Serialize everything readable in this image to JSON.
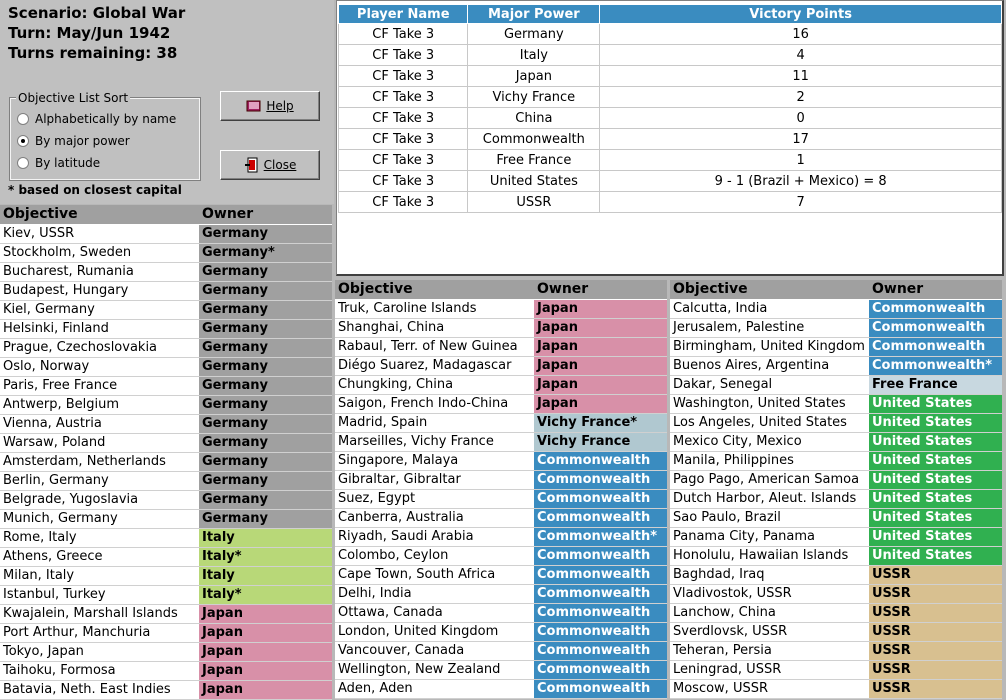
{
  "scenario": {
    "line1": "Scenario: Global War",
    "line2": "Turn: May/Jun 1942",
    "line3": "Turns remaining: 38"
  },
  "sort": {
    "legend": "Objective List Sort",
    "options": [
      "Alphabetically by name",
      "By major power",
      "By latitude"
    ],
    "selected_index": 1
  },
  "footnote": "* based on closest capital",
  "buttons": {
    "help": "Help",
    "close": "Close"
  },
  "vp_table": {
    "headers": [
      "Player Name",
      "Major Power",
      "Victory Points"
    ],
    "rows": [
      [
        "CF Take 3",
        "Germany",
        "16"
      ],
      [
        "CF Take 3",
        "Italy",
        "4"
      ],
      [
        "CF Take 3",
        "Japan",
        "11"
      ],
      [
        "CF Take 3",
        "Vichy France",
        "2"
      ],
      [
        "CF Take 3",
        "China",
        "0"
      ],
      [
        "CF Take 3",
        "Commonwealth",
        "17"
      ],
      [
        "CF Take 3",
        "Free France",
        "1"
      ],
      [
        "CF Take 3",
        "United States",
        "9 - 1 (Brazil + Mexico) = 8"
      ],
      [
        "CF Take 3",
        "USSR",
        "7"
      ]
    ]
  },
  "owner_colors": {
    "Germany": "#a0a0a0",
    "Italy": "#b8d878",
    "Japan": "#d890a8",
    "Vichy France": "#b0c8d0",
    "Commonwealth": "#3a8cc0",
    "Free France": "#c8d8e0",
    "United States": "#30b050",
    "USSR": "#d8c090"
  },
  "objective_lists": [
    {
      "headers": [
        "Objective",
        "Owner"
      ],
      "rows": [
        [
          "Kiev, USSR",
          "Germany"
        ],
        [
          "Stockholm, Sweden",
          "Germany*"
        ],
        [
          "Bucharest, Rumania",
          "Germany"
        ],
        [
          "Budapest, Hungary",
          "Germany"
        ],
        [
          "Kiel, Germany",
          "Germany"
        ],
        [
          "Helsinki, Finland",
          "Germany"
        ],
        [
          "Prague, Czechoslovakia",
          "Germany"
        ],
        [
          "Oslo, Norway",
          "Germany"
        ],
        [
          "Paris, Free France",
          "Germany"
        ],
        [
          "Antwerp, Belgium",
          "Germany"
        ],
        [
          "Vienna, Austria",
          "Germany"
        ],
        [
          "Warsaw, Poland",
          "Germany"
        ],
        [
          "Amsterdam, Netherlands",
          "Germany"
        ],
        [
          "Berlin, Germany",
          "Germany"
        ],
        [
          "Belgrade, Yugoslavia",
          "Germany"
        ],
        [
          "Munich, Germany",
          "Germany"
        ],
        [
          "Rome, Italy",
          "Italy"
        ],
        [
          "Athens, Greece",
          "Italy*"
        ],
        [
          "Milan, Italy",
          "Italy"
        ],
        [
          "Istanbul, Turkey",
          "Italy*"
        ],
        [
          "Kwajalein, Marshall Islands",
          "Japan"
        ],
        [
          "Port Arthur, Manchuria",
          "Japan"
        ],
        [
          "Tokyo, Japan",
          "Japan"
        ],
        [
          "Taihoku, Formosa",
          "Japan"
        ],
        [
          "Batavia, Neth. East Indies",
          "Japan"
        ]
      ]
    },
    {
      "headers": [
        "Objective",
        "Owner"
      ],
      "rows": [
        [
          "Truk, Caroline Islands",
          "Japan"
        ],
        [
          "Shanghai, China",
          "Japan"
        ],
        [
          "Rabaul, Terr. of New Guinea",
          "Japan"
        ],
        [
          "Diégo Suarez, Madagascar",
          "Japan"
        ],
        [
          "Chungking, China",
          "Japan"
        ],
        [
          "Saigon, French Indo-China",
          "Japan"
        ],
        [
          "Madrid, Spain",
          "Vichy France*"
        ],
        [
          "Marseilles, Vichy France",
          "Vichy France"
        ],
        [
          "Singapore, Malaya",
          "Commonwealth"
        ],
        [
          "Gibraltar, Gibraltar",
          "Commonwealth"
        ],
        [
          "Suez, Egypt",
          "Commonwealth"
        ],
        [
          "Canberra, Australia",
          "Commonwealth"
        ],
        [
          "Riyadh, Saudi Arabia",
          "Commonwealth*"
        ],
        [
          "Colombo, Ceylon",
          "Commonwealth"
        ],
        [
          "Cape Town, South Africa",
          "Commonwealth"
        ],
        [
          "Delhi, India",
          "Commonwealth"
        ],
        [
          "Ottawa, Canada",
          "Commonwealth"
        ],
        [
          "London, United Kingdom",
          "Commonwealth"
        ],
        [
          "Vancouver, Canada",
          "Commonwealth"
        ],
        [
          "Wellington, New Zealand",
          "Commonwealth"
        ],
        [
          "Aden, Aden",
          "Commonwealth"
        ]
      ]
    },
    {
      "headers": [
        "Objective",
        "Owner"
      ],
      "rows": [
        [
          "Calcutta, India",
          "Commonwealth"
        ],
        [
          "Jerusalem, Palestine",
          "Commonwealth"
        ],
        [
          "Birmingham, United Kingdom",
          "Commonwealth"
        ],
        [
          "Buenos Aires, Argentina",
          "Commonwealth*"
        ],
        [
          "Dakar, Senegal",
          "Free France"
        ],
        [
          "Washington, United States",
          "United States"
        ],
        [
          "Los Angeles, United States",
          "United States"
        ],
        [
          "Mexico City, Mexico",
          "United States"
        ],
        [
          "Manila, Philippines",
          "United States"
        ],
        [
          "Pago Pago, American Samoa",
          "United States"
        ],
        [
          "Dutch Harbor, Aleut. Islands",
          "United States"
        ],
        [
          "Sao Paulo, Brazil",
          "United States"
        ],
        [
          "Panama City, Panama",
          "United States"
        ],
        [
          "Honolulu, Hawaiian Islands",
          "United States"
        ],
        [
          "Baghdad, Iraq",
          "USSR"
        ],
        [
          "Vladivostok, USSR",
          "USSR"
        ],
        [
          "Lanchow, China",
          "USSR"
        ],
        [
          "Sverdlovsk, USSR",
          "USSR"
        ],
        [
          "Teheran, Persia",
          "USSR"
        ],
        [
          "Leningrad, USSR",
          "USSR"
        ],
        [
          "Moscow, USSR",
          "USSR"
        ]
      ]
    }
  ]
}
